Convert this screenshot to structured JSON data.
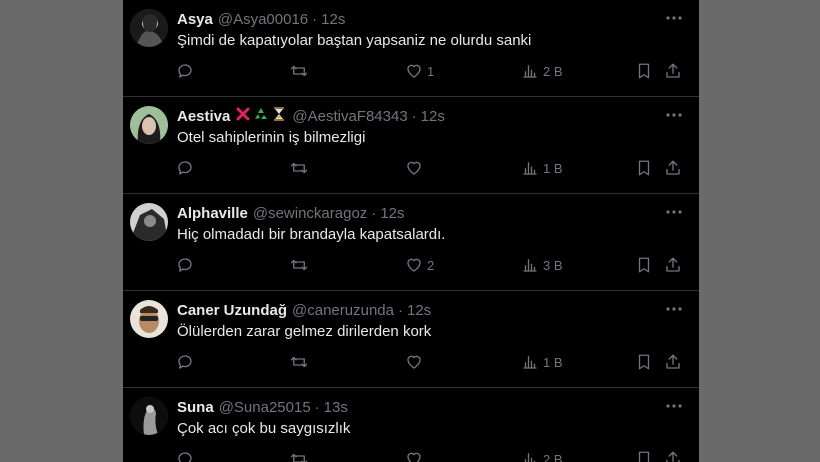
{
  "tweets": [
    {
      "name": "Asya",
      "handle": "@Asya00016",
      "time": "12s",
      "text": "Şimdi de kapatıyolar baştan yapsaniz ne olurdu sanki",
      "likes": "1",
      "views": "2 B",
      "avatar": "avatar-dark-portrait"
    },
    {
      "name": "Aestiva",
      "handle": "@AestivaF84343",
      "time": "12s",
      "text": "Otel sahiplerinin iş bilmezligi",
      "likes": "",
      "views": "1 B",
      "avatar": "avatar-green-portrait",
      "emojis": [
        "cross-mark-icon",
        "recycle-icon",
        "hourglass-icon"
      ]
    },
    {
      "name": "Alphaville",
      "handle": "@sewinckaragoz",
      "time": "12s",
      "text": "Hiç olmadadı bir brandayla kapatsalardı.",
      "likes": "2",
      "views": "3 B",
      "avatar": "avatar-bw-portrait"
    },
    {
      "name": "Caner Uzundağ",
      "handle": "@caneruzunda",
      "time": "12s",
      "text": "Ölülerden zarar gelmez dirilerden kork",
      "likes": "",
      "views": "1 B",
      "avatar": "avatar-man-sunglasses"
    },
    {
      "name": "Suna",
      "handle": "@Suna25015",
      "time": "13s",
      "text": "Çok acı çok bu saygısızlık",
      "likes": "",
      "views": "2 B",
      "avatar": "avatar-dark-figure"
    }
  ],
  "colors": {
    "background": "#000000",
    "text": "#e7e9ea",
    "muted": "#71767b",
    "border": "#2f3336"
  }
}
